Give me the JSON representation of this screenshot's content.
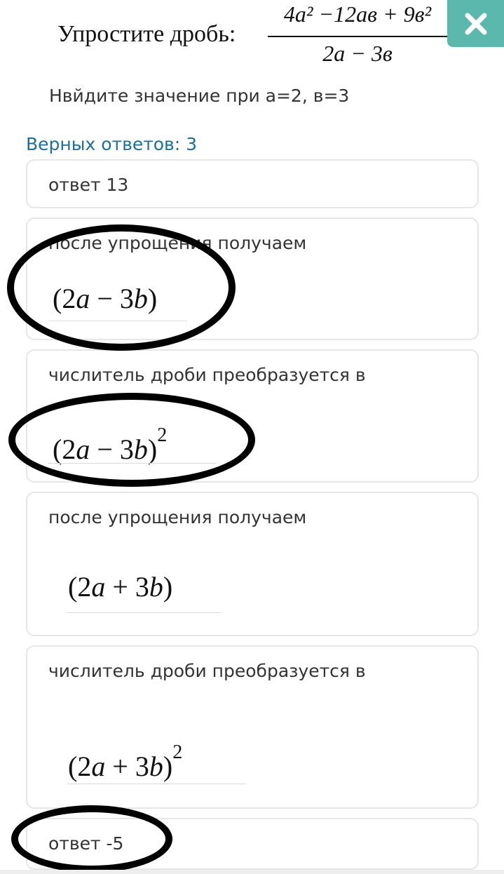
{
  "question": {
    "prefix": "Упростите дробь:",
    "numerator_text": "4a² −12ав + 9в²",
    "denominator_text": "2a − 3в",
    "subtitle": "Нвйдите значение при а=2, в=3"
  },
  "close_button": {
    "icon": "close-icon",
    "color": "#5bb8ac"
  },
  "answers_count": "Верных ответов: 3",
  "options": [
    {
      "text": "ответ 13"
    },
    {
      "text": "после упрощения получаем",
      "formula": "(2a − 3b)",
      "circled": true
    },
    {
      "text": "числитель дроби преобразуется в",
      "formula": "(2a − 3b)²",
      "circled": true
    },
    {
      "text": "после упрощения получаем",
      "formula": "(2a + 3b)"
    },
    {
      "text": "числитель дроби преобразуется в",
      "formula": "(2a + 3b)²"
    },
    {
      "text": "ответ -5",
      "circled": true
    }
  ],
  "colors": {
    "accent": "#5bb8ac",
    "answers_count": "#1a6fa0",
    "text": "#333333",
    "border": "#e6e6e6"
  }
}
